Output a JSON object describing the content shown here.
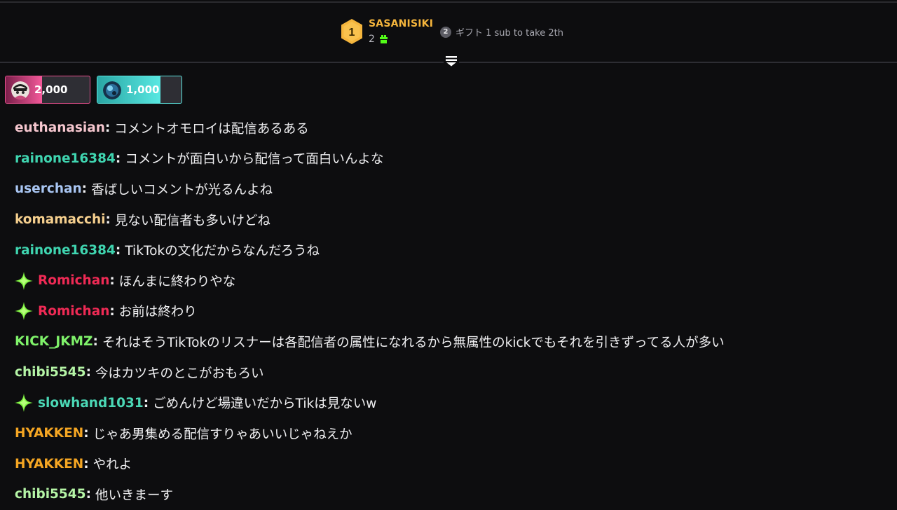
{
  "leaderboard": {
    "rank": "1",
    "name": "SASANISIKI",
    "count": "2",
    "next_rank": "2",
    "next_text": "ギフト 1 sub to take 2th",
    "colors": {
      "rank_gold": "#f5b53c",
      "gift_green": "#53fc18"
    }
  },
  "goals": [
    {
      "amount": "2,000",
      "progress": 0.43,
      "color": "#f4599a",
      "icon": "avatar-icon"
    },
    {
      "amount": "1,000",
      "progress": 0.75,
      "color": "#58e8e2",
      "icon": "orb-icon"
    }
  ],
  "chat": [
    {
      "user": "euthanasian",
      "color": "#f6c7cf",
      "text": "コメントオモロイは配信あるある",
      "badge": false
    },
    {
      "user": "rainone16384",
      "color": "#3fd5b0",
      "text": "コメントが面白いから配信って面白いんよな",
      "badge": false
    },
    {
      "user": "userchan",
      "color": "#a9c6f3",
      "text": "香ばしいコメントが光るんよね",
      "badge": false
    },
    {
      "user": "komamacchi",
      "color": "#f5cf8e",
      "text": "見ない配信者も多いけどね",
      "badge": false
    },
    {
      "user": "rainone16384",
      "color": "#3fd5b0",
      "text": "TikTokの文化だからなんだろうね",
      "badge": false
    },
    {
      "user": "Romichan",
      "color": "#f02a55",
      "text": "ほんまに終わりやな",
      "badge": true
    },
    {
      "user": "Romichan",
      "color": "#f02a55",
      "text": "お前は終わり",
      "badge": true
    },
    {
      "user": "KICK_JKMZ",
      "color": "#7ff26a",
      "text": "それはそうTikTokのリスナーは各配信者の属性になれるから無属性のkickでもそれを引きずってる人が多い",
      "badge": false
    },
    {
      "user": "chibi5545",
      "color": "#b5f5a6",
      "text": "今はカツキのとこがおもろい",
      "badge": false
    },
    {
      "user": "slowhand1031",
      "color": "#4bd8b6",
      "text": "ごめんけど場違いだからTikは見ないw",
      "badge": true
    },
    {
      "user": "HYAKKEN",
      "color": "#f5a623",
      "text": "じゃあ男集める配信すりゃあいいじゃねえか",
      "badge": false
    },
    {
      "user": "HYAKKEN",
      "color": "#f5a623",
      "text": "やれよ",
      "badge": false
    },
    {
      "user": "chibi5545",
      "color": "#b5f5a6",
      "text": "他いきまーす",
      "badge": false
    }
  ]
}
